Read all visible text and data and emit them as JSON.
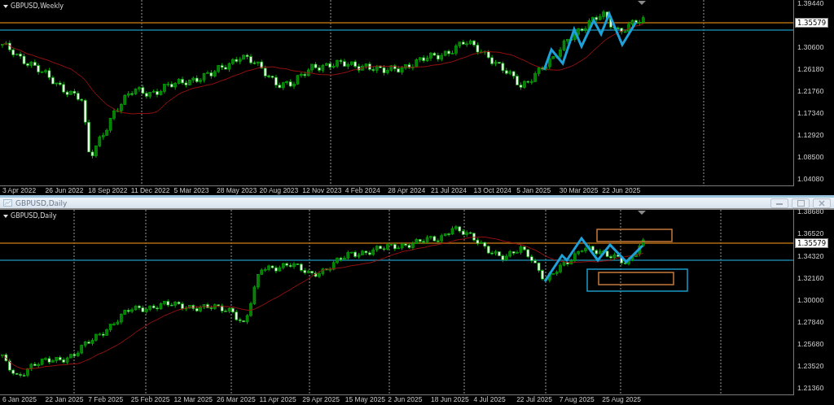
{
  "charts": [
    {
      "kind": "weekly",
      "label": "GBPUSD,Weekly",
      "current_price": "1.35579",
      "price_ticks": [
        "1.39440",
        "1.30600",
        "1.26180",
        "1.21760",
        "1.17340",
        "1.12920",
        "1.08500",
        "1.04080"
      ],
      "date_labels": [
        "3 Apr 2022",
        "26 Jun 2022",
        "18 Sep 2022",
        "11 Dec 2022",
        "5 Mar 2023",
        "28 May 2023",
        "20 Aug 2023",
        "12 Nov 2023",
        "4 Feb 2024",
        "28 Apr 2024",
        "21 Jul 2024",
        "13 Oct 2024",
        "5 Jan 2025",
        "30 Mar 2025",
        "22 Jun 2025"
      ]
    },
    {
      "kind": "daily",
      "title_bar": {
        "title": "GBPUSD,Daily"
      },
      "label": "GBPUSD,Daily",
      "current_price": "1.35579",
      "price_ticks": [
        "1.38680",
        "1.36520",
        "1.34320",
        "1.32160",
        "1.30000",
        "1.27840",
        "1.25680",
        "1.23520",
        "1.21360"
      ],
      "date_labels": [
        "6 Jan 2025",
        "22 Jan 2025",
        "7 Feb 2025",
        "25 Feb 2025",
        "12 Mar 2025",
        "26 Mar 2025",
        "11 Apr 2025",
        "29 Apr 2025",
        "15 May 2025",
        "2 Jun 2025",
        "18 Jun 2025",
        "4 Jul 2025",
        "22 Jul 2025",
        "7 Aug 2025",
        "25 Aug 2025"
      ]
    }
  ]
}
